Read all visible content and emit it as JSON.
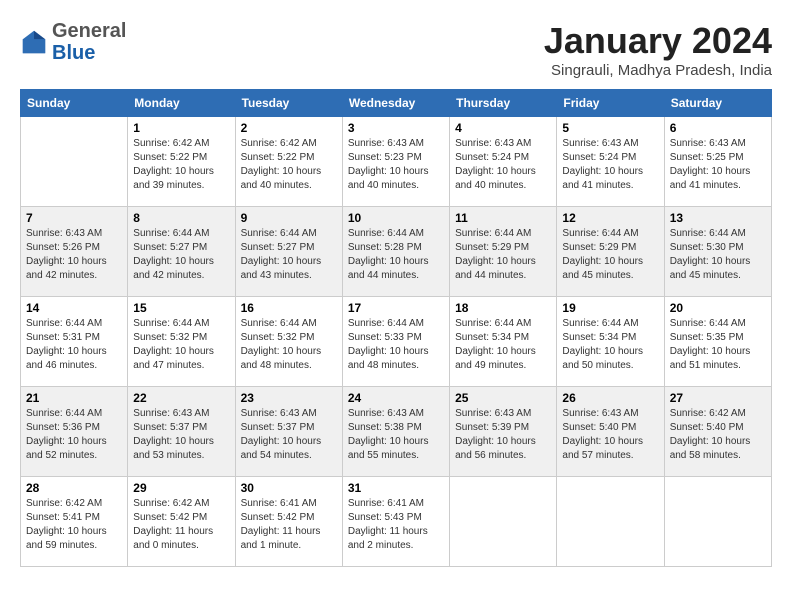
{
  "header": {
    "logo_line1": "General",
    "logo_line2": "Blue",
    "month": "January 2024",
    "location": "Singrauli, Madhya Pradesh, India"
  },
  "weekdays": [
    "Sunday",
    "Monday",
    "Tuesday",
    "Wednesday",
    "Thursday",
    "Friday",
    "Saturday"
  ],
  "weeks": [
    [
      {
        "day": "",
        "info": ""
      },
      {
        "day": "1",
        "info": "Sunrise: 6:42 AM\nSunset: 5:22 PM\nDaylight: 10 hours\nand 39 minutes."
      },
      {
        "day": "2",
        "info": "Sunrise: 6:42 AM\nSunset: 5:22 PM\nDaylight: 10 hours\nand 40 minutes."
      },
      {
        "day": "3",
        "info": "Sunrise: 6:43 AM\nSunset: 5:23 PM\nDaylight: 10 hours\nand 40 minutes."
      },
      {
        "day": "4",
        "info": "Sunrise: 6:43 AM\nSunset: 5:24 PM\nDaylight: 10 hours\nand 40 minutes."
      },
      {
        "day": "5",
        "info": "Sunrise: 6:43 AM\nSunset: 5:24 PM\nDaylight: 10 hours\nand 41 minutes."
      },
      {
        "day": "6",
        "info": "Sunrise: 6:43 AM\nSunset: 5:25 PM\nDaylight: 10 hours\nand 41 minutes."
      }
    ],
    [
      {
        "day": "7",
        "info": "Sunrise: 6:43 AM\nSunset: 5:26 PM\nDaylight: 10 hours\nand 42 minutes."
      },
      {
        "day": "8",
        "info": "Sunrise: 6:44 AM\nSunset: 5:27 PM\nDaylight: 10 hours\nand 42 minutes."
      },
      {
        "day": "9",
        "info": "Sunrise: 6:44 AM\nSunset: 5:27 PM\nDaylight: 10 hours\nand 43 minutes."
      },
      {
        "day": "10",
        "info": "Sunrise: 6:44 AM\nSunset: 5:28 PM\nDaylight: 10 hours\nand 44 minutes."
      },
      {
        "day": "11",
        "info": "Sunrise: 6:44 AM\nSunset: 5:29 PM\nDaylight: 10 hours\nand 44 minutes."
      },
      {
        "day": "12",
        "info": "Sunrise: 6:44 AM\nSunset: 5:29 PM\nDaylight: 10 hours\nand 45 minutes."
      },
      {
        "day": "13",
        "info": "Sunrise: 6:44 AM\nSunset: 5:30 PM\nDaylight: 10 hours\nand 45 minutes."
      }
    ],
    [
      {
        "day": "14",
        "info": "Sunrise: 6:44 AM\nSunset: 5:31 PM\nDaylight: 10 hours\nand 46 minutes."
      },
      {
        "day": "15",
        "info": "Sunrise: 6:44 AM\nSunset: 5:32 PM\nDaylight: 10 hours\nand 47 minutes."
      },
      {
        "day": "16",
        "info": "Sunrise: 6:44 AM\nSunset: 5:32 PM\nDaylight: 10 hours\nand 48 minutes."
      },
      {
        "day": "17",
        "info": "Sunrise: 6:44 AM\nSunset: 5:33 PM\nDaylight: 10 hours\nand 48 minutes."
      },
      {
        "day": "18",
        "info": "Sunrise: 6:44 AM\nSunset: 5:34 PM\nDaylight: 10 hours\nand 49 minutes."
      },
      {
        "day": "19",
        "info": "Sunrise: 6:44 AM\nSunset: 5:34 PM\nDaylight: 10 hours\nand 50 minutes."
      },
      {
        "day": "20",
        "info": "Sunrise: 6:44 AM\nSunset: 5:35 PM\nDaylight: 10 hours\nand 51 minutes."
      }
    ],
    [
      {
        "day": "21",
        "info": "Sunrise: 6:44 AM\nSunset: 5:36 PM\nDaylight: 10 hours\nand 52 minutes."
      },
      {
        "day": "22",
        "info": "Sunrise: 6:43 AM\nSunset: 5:37 PM\nDaylight: 10 hours\nand 53 minutes."
      },
      {
        "day": "23",
        "info": "Sunrise: 6:43 AM\nSunset: 5:37 PM\nDaylight: 10 hours\nand 54 minutes."
      },
      {
        "day": "24",
        "info": "Sunrise: 6:43 AM\nSunset: 5:38 PM\nDaylight: 10 hours\nand 55 minutes."
      },
      {
        "day": "25",
        "info": "Sunrise: 6:43 AM\nSunset: 5:39 PM\nDaylight: 10 hours\nand 56 minutes."
      },
      {
        "day": "26",
        "info": "Sunrise: 6:43 AM\nSunset: 5:40 PM\nDaylight: 10 hours\nand 57 minutes."
      },
      {
        "day": "27",
        "info": "Sunrise: 6:42 AM\nSunset: 5:40 PM\nDaylight: 10 hours\nand 58 minutes."
      }
    ],
    [
      {
        "day": "28",
        "info": "Sunrise: 6:42 AM\nSunset: 5:41 PM\nDaylight: 10 hours\nand 59 minutes."
      },
      {
        "day": "29",
        "info": "Sunrise: 6:42 AM\nSunset: 5:42 PM\nDaylight: 11 hours\nand 0 minutes."
      },
      {
        "day": "30",
        "info": "Sunrise: 6:41 AM\nSunset: 5:42 PM\nDaylight: 11 hours\nand 1 minute."
      },
      {
        "day": "31",
        "info": "Sunrise: 6:41 AM\nSunset: 5:43 PM\nDaylight: 11 hours\nand 2 minutes."
      },
      {
        "day": "",
        "info": ""
      },
      {
        "day": "",
        "info": ""
      },
      {
        "day": "",
        "info": ""
      }
    ]
  ]
}
